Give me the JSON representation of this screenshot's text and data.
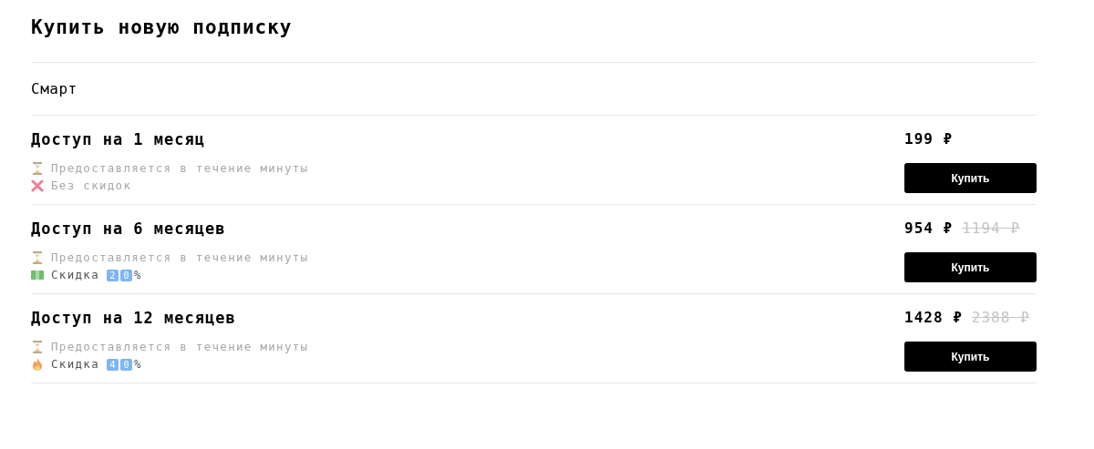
{
  "title": "Купить новую подписку",
  "section": "Смарт",
  "plans": [
    {
      "name": "Доступ на 1 месяц",
      "price": "199 ₽",
      "button": "Купить",
      "features": [
        {
          "kind": "hourglass",
          "text": "Предоставляется в течение минуты",
          "emphasized": false
        },
        {
          "kind": "cross",
          "text": "Без скидок",
          "emphasized": false
        }
      ]
    },
    {
      "name": "Доступ на 6 месяцев",
      "price": "954 ₽",
      "old_price": "1194 ₽",
      "button": "Купить",
      "features": [
        {
          "kind": "hourglass",
          "text": "Предоставляется в течение минуты",
          "emphasized": false
        },
        {
          "kind": "money",
          "text": "Скидка",
          "emphasized": true,
          "badges": [
            "2",
            "0"
          ],
          "suffix": "%"
        }
      ]
    },
    {
      "name": "Доступ на 12 месяцев",
      "price": "1428 ₽",
      "old_price": "2388 ₽",
      "button": "Купить",
      "features": [
        {
          "kind": "hourglass",
          "text": "Предоставляется в течение минуты",
          "emphasized": false
        },
        {
          "kind": "fire",
          "text": "Скидка",
          "emphasized": true,
          "badges": [
            "4",
            "0"
          ],
          "suffix": "%"
        }
      ]
    }
  ]
}
